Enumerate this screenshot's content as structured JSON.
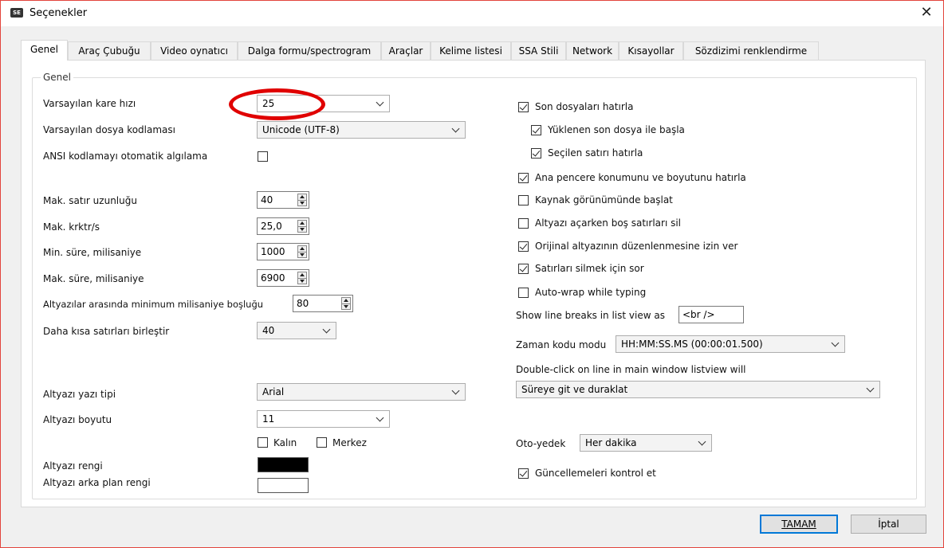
{
  "window": {
    "title": "Seçenekler",
    "app_icon_text": "SE",
    "close_icon": "close-icon"
  },
  "tabs": [
    {
      "label": "Genel",
      "active": true
    },
    {
      "label": "Araç Çubuğu"
    },
    {
      "label": "Video oynatıcı"
    },
    {
      "label": "Dalga formu/spectrogram"
    },
    {
      "label": "Araçlar"
    },
    {
      "label": "Kelime listesi"
    },
    {
      "label": "SSA Stili"
    },
    {
      "label": "Network"
    },
    {
      "label": "Kısayollar"
    },
    {
      "label": "Sözdizimi renklendirme"
    }
  ],
  "group": {
    "label": "Genel"
  },
  "left": {
    "frame_rate_label": "Varsayılan kare hızı",
    "frame_rate_value": "25",
    "encoding_label": "Varsayılan dosya kodlaması",
    "encoding_value": "Unicode (UTF-8)",
    "ansi_label": "ANSI kodlamayı otomatik algılama",
    "ansi_checked": false,
    "max_line_len_label": "Mak. satır uzunluğu",
    "max_line_len_value": "40",
    "max_cps_label": "Mak. krktr/s",
    "max_cps_value": "25,0",
    "min_dur_label": "Min. süre, milisaniye",
    "min_dur_value": "1000",
    "max_dur_label": "Mak. süre, milisaniye",
    "max_dur_value": "6900",
    "min_gap_label": "Altyazılar arasında minimum milisaniye boşluğu",
    "min_gap_value": "80",
    "merge_label": "Daha kısa satırları birleştir",
    "merge_value": "40",
    "font_label": "Altyazı yazı tipi",
    "font_value": "Arial",
    "size_label": "Altyazı boyutu",
    "size_value": "11",
    "bold_label": "Kalın",
    "bold_checked": false,
    "center_label": "Merkez",
    "center_checked": false,
    "color_label": "Altyazı rengi",
    "color_value": "#000000",
    "bg_color_label": "Altyazı arka plan rengi",
    "bg_color_value": "#ffffff"
  },
  "right": {
    "checks": [
      {
        "label": "Son dosyaları hatırla",
        "checked": true
      },
      {
        "label": "Yüklenen son dosya ile başla",
        "checked": true
      },
      {
        "label": "Seçilen satırı hatırla",
        "checked": true
      },
      {
        "label": "Ana pencere konumunu ve boyutunu hatırla",
        "checked": true
      },
      {
        "label": "Kaynak görünümünde başlat",
        "checked": false
      },
      {
        "label": "Altyazı açarken boş satırları sil",
        "checked": false
      },
      {
        "label": "Orijinal altyazının düzenlenmesine izin ver",
        "checked": true
      },
      {
        "label": "Satırları silmek için sor",
        "checked": true
      },
      {
        "label": "Auto-wrap while typing",
        "checked": false
      }
    ],
    "line_breaks_label": "Show line breaks in list view as",
    "line_breaks_value": "<br />",
    "timecode_label": "Zaman kodu modu",
    "timecode_value": "HH:MM:SS.MS (00:00:01.500)",
    "dblclick_label": "Double-click on line in main window listview will",
    "dblclick_value": "Süreye git ve duraklat",
    "autobackup_label": "Oto-yedek",
    "autobackup_value": "Her dakika",
    "updates_label": "Güncellemeleri kontrol et",
    "updates_checked": true
  },
  "buttons": {
    "ok": "TAMAM",
    "cancel": "İptal"
  },
  "highlight": {
    "color": "#e00000",
    "target": "frame-rate-combo"
  }
}
